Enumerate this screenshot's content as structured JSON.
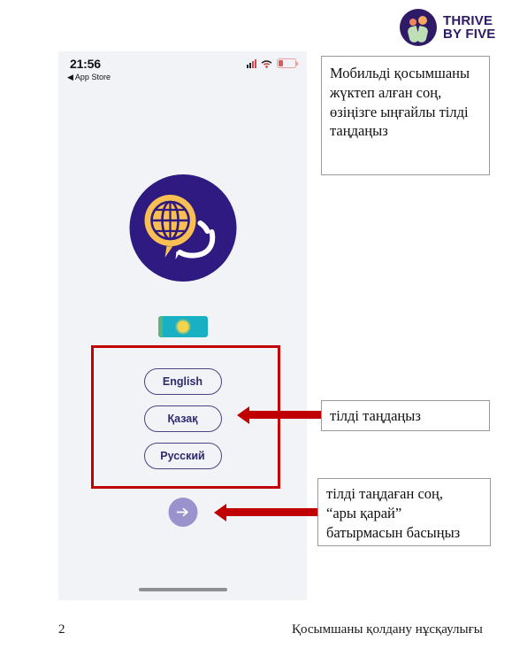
{
  "brand": {
    "line1": "THRIVE",
    "line2": "BY FIVE",
    "mark_icon": "thrive-by-five-logo-icon",
    "colors": {
      "circle": "#2e1a66",
      "dot_a": "#f2845c",
      "dot_b": "#f6a85f",
      "leaf": "#bfe0b4"
    }
  },
  "phone": {
    "status_bar": {
      "time": "21:56",
      "location_arrow_icon": "location-arrow-icon",
      "back_label": "◀ App Store",
      "signal_icon": "cellular-signal-icon",
      "wifi_icon": "wifi-icon",
      "battery_icon": "battery-low-icon"
    },
    "app_logo_icon": "globe-speech-bubble-app-icon",
    "flag": {
      "name": "kazakhstan-flag-icon",
      "colors": {
        "field": "#19b0c4",
        "sun": "#f4d44a",
        "hoist": "#5bb47e"
      }
    },
    "languages": [
      {
        "label": "English"
      },
      {
        "label": "Қазақ"
      },
      {
        "label": "Русский"
      }
    ],
    "next_button": {
      "icon": "arrow-right-icon",
      "color": "#9a92cc"
    },
    "home_indicator_icon": "home-indicator-bar"
  },
  "annotations": {
    "highlight_color": "#c00000",
    "top": "Мобильді қосымшаны жүктеп алған соң, өзіңізге ыңғайлы тілді таңдаңыз",
    "middle": "тілді таңдаңыз",
    "bottom_line1": "тілді таңдаған соң,",
    "bottom_line2": "“ары қарай”",
    "bottom_line3": "батырмасын басыңыз"
  },
  "footer": {
    "page_number": "2",
    "title": "Қосымшаны қолдану нұсқаулығы"
  }
}
